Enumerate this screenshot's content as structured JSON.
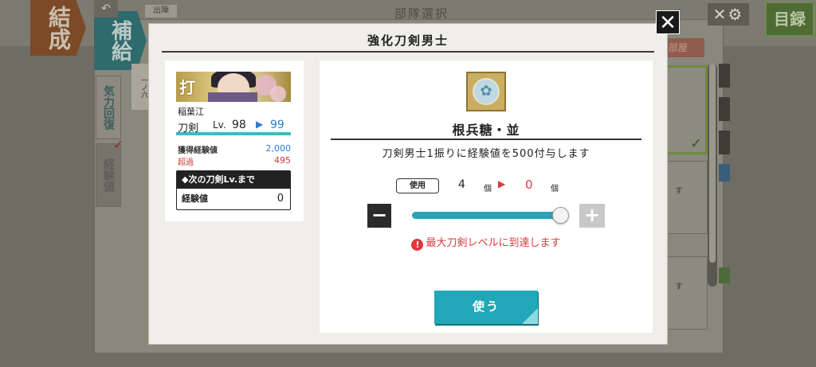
{
  "background": {
    "screen_title": "部隊選択",
    "subtab": "出陣",
    "tabs": [
      {
        "label": "結成"
      },
      {
        "label": "補給"
      }
    ],
    "side_tabs": [
      {
        "label": "気力回復"
      },
      {
        "label": "経験値"
      }
    ],
    "card_text": "一ノ六",
    "right_tab": "部屋",
    "right_rows": [
      {
        "text": "す"
      },
      {
        "text": "す"
      }
    ],
    "settings_label": "✕⚙",
    "mokuroku_label": "目録"
  },
  "modal": {
    "title": "強化刀剣男士",
    "close_label": "✕",
    "sword": {
      "type_mark": "打",
      "name": "稲葉江",
      "kind": "刀剣",
      "lv_label": "Lv.",
      "lv_current": "98",
      "lv_next": "99",
      "exp_gained_label": "獲得経験値",
      "exp_gained_value": "2,000",
      "over_label": "超過",
      "over_value": "495",
      "next_box_title": "◆次の刀剣Lv.まで",
      "next_exp_label": "経験値",
      "next_exp_value": "0"
    },
    "item": {
      "name": "根兵糖・並",
      "description": "刀剣男士1振りに経験値を500付与します",
      "use_label": "使用",
      "count_current": "4",
      "count_unit": "個",
      "count_new": "0",
      "slider_fraction": 1.0,
      "warning": "最大刀剣レベルに到達します",
      "use_button": "使う"
    }
  },
  "colors": {
    "accent_teal": "#21a7b8",
    "warning_red": "#e0393e",
    "level_blue": "#2f7bd0"
  }
}
